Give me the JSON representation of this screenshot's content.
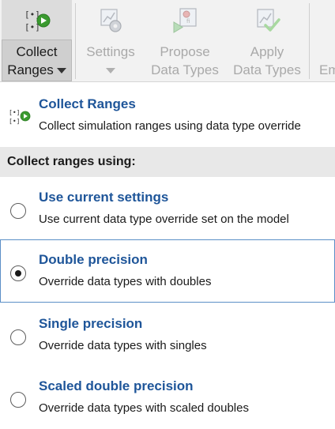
{
  "toolbar": {
    "collect": {
      "line1": "Collect",
      "line2": "Ranges"
    },
    "settings": {
      "label": "Settings"
    },
    "propose": {
      "line1": "Propose",
      "line2": "Data Types"
    },
    "apply": {
      "line1": "Apply",
      "line2": "Data Types"
    },
    "cut_off": {
      "label": "Em"
    }
  },
  "menu": {
    "header": {
      "title": "Collect Ranges",
      "description": "Collect simulation ranges using data type override"
    },
    "section_title": "Collect ranges using:",
    "options": [
      {
        "title": "Use current settings",
        "description": "Use current data type override set on the model",
        "selected": false
      },
      {
        "title": "Double precision",
        "description": "Override data types with doubles",
        "selected": true
      },
      {
        "title": "Single precision",
        "description": "Override data types with singles",
        "selected": false
      },
      {
        "title": "Scaled double precision",
        "description": "Override data types with scaled doubles",
        "selected": false
      }
    ]
  },
  "colors": {
    "link_blue": "#1e5599",
    "selection_border": "#5b8fc7",
    "play_green": "#3a9a2f"
  }
}
